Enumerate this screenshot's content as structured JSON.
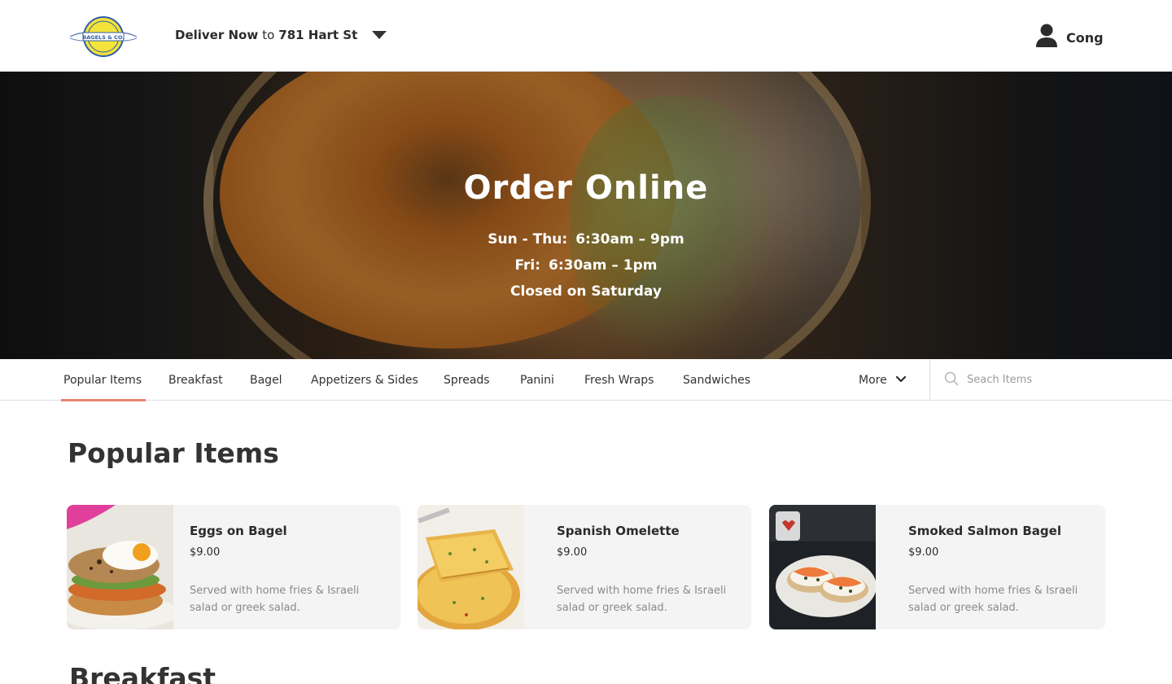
{
  "header": {
    "logo_text": "BAGELS & CO.",
    "deliver_label": "Deliver Now",
    "deliver_to": "to",
    "address": "781 Hart St",
    "user_name": "Cong"
  },
  "hero": {
    "title": "Order Online",
    "hours": [
      {
        "days": "Sun - Thu:",
        "time": "6:30am – 9pm"
      },
      {
        "days": "Fri:",
        "time": "6:30am – 1pm"
      }
    ],
    "closed_note": "Closed on Saturday"
  },
  "nav": {
    "tabs": [
      {
        "label": "Popular Items",
        "active": true
      },
      {
        "label": "Breakfast"
      },
      {
        "label": "Bagel"
      },
      {
        "label": "Appetizers & Sides"
      },
      {
        "label": "Spreads"
      },
      {
        "label": "Panini"
      },
      {
        "label": "Fresh Wraps"
      },
      {
        "label": "Sandwiches"
      }
    ],
    "more_label": "More",
    "search_placeholder": "Seach Items"
  },
  "sections": {
    "popular_title": "Popular Items",
    "breakfast_title": "Breakfast"
  },
  "popular_items": [
    {
      "name": "Eggs on Bagel",
      "price": "$9.00",
      "description": "Served with home fries & Israeli salad or greek salad."
    },
    {
      "name": "Spanish Omelette",
      "price": "$9.00",
      "description": "Served with home fries & Israeli salad or greek salad."
    },
    {
      "name": "Smoked Salmon Bagel",
      "price": "$9.00",
      "description": "Served with home fries & Israeli salad or greek salad."
    }
  ],
  "colors": {
    "accent_underline": "#e6836f",
    "card_background": "#f4f4f4",
    "logo_yellow": "#f3e33b",
    "logo_blue": "#2f5da8"
  }
}
